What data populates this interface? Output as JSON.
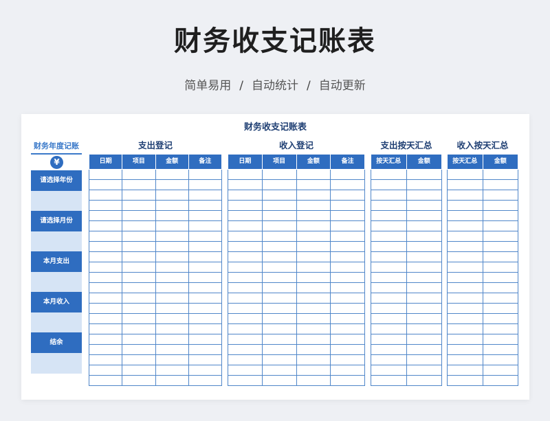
{
  "page": {
    "title": "财务收支记账表",
    "subtitle_parts": [
      "简单易用",
      "自动统计",
      "自动更新"
    ],
    "separator": "/"
  },
  "sheet": {
    "title": "财务收支记账表",
    "sidebar": {
      "title": "财务年度记账",
      "currency_symbol": "¥",
      "blocks": [
        {
          "label": "请选择年份",
          "value": ""
        },
        {
          "label": "请选择月份",
          "value": ""
        },
        {
          "label": "本月支出",
          "value": ""
        },
        {
          "label": "本月收入",
          "value": ""
        },
        {
          "label": "结余",
          "value": ""
        }
      ]
    },
    "tables": [
      {
        "title": "支出登记",
        "columns": [
          "日期",
          "项目",
          "金额",
          "备注"
        ]
      },
      {
        "title": "收入登记",
        "columns": [
          "日期",
          "项目",
          "金额",
          "备注"
        ]
      },
      {
        "title": "支出按天汇总",
        "columns": [
          "按天汇总",
          "金额"
        ]
      },
      {
        "title": "收入按天汇总",
        "columns": [
          "按天汇总",
          "金额"
        ]
      }
    ],
    "empty_row_count": 21
  },
  "colors": {
    "header_blue": "#2f6dc0",
    "title_navy": "#1f3f73",
    "value_fill": "#d6e4f5",
    "grid_line": "#4f86c9"
  }
}
